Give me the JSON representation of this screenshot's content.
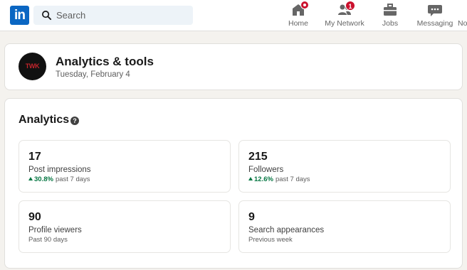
{
  "nav": {
    "search_placeholder": "Search",
    "items": [
      {
        "label": "Home",
        "icon": "home-icon",
        "badge": ""
      },
      {
        "label": "My Network",
        "icon": "network-icon",
        "badge": "1"
      },
      {
        "label": "Jobs",
        "icon": "briefcase-icon",
        "badge": ""
      },
      {
        "label": "Messaging",
        "icon": "messaging-icon",
        "badge": ""
      },
      {
        "label": "No",
        "icon": "notifications-icon",
        "badge": ""
      }
    ],
    "logo_text": "in"
  },
  "header": {
    "title": "Analytics & tools",
    "date": "Tuesday, February 4",
    "avatar_text": "TWK"
  },
  "analytics": {
    "title": "Analytics",
    "help_icon": "?",
    "metrics": [
      {
        "value": "17",
        "label": "Post impressions",
        "change": "30.8%",
        "period": "past 7 days",
        "trend": "up"
      },
      {
        "value": "215",
        "label": "Followers",
        "change": "12.6%",
        "period": "past 7 days",
        "trend": "up"
      },
      {
        "value": "90",
        "label": "Profile viewers",
        "period": "Past 90 days"
      },
      {
        "value": "9",
        "label": "Search appearances",
        "period": "Previous week"
      }
    ]
  },
  "colors": {
    "brand": "#0a66c2",
    "positive": "#057642",
    "badge": "#cb112d",
    "background": "#f4f2ee"
  }
}
